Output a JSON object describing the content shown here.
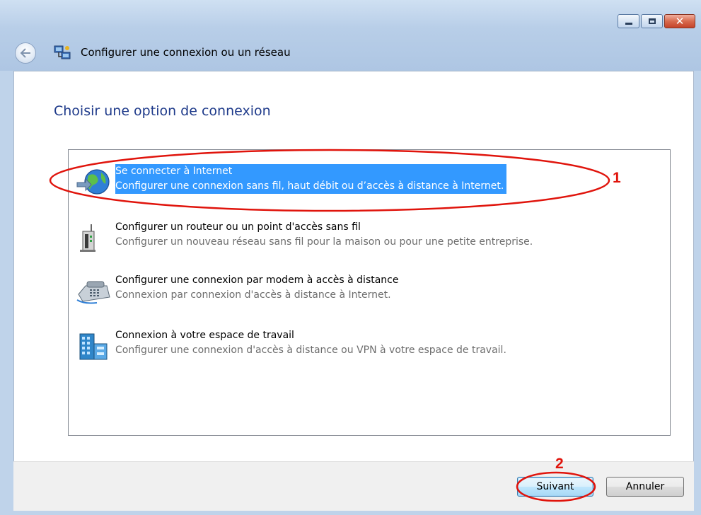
{
  "window": {
    "title": "Configurer une connexion ou un réseau",
    "caption_buttons": [
      "minimize-icon",
      "maximize-icon",
      "close-icon"
    ]
  },
  "page": {
    "heading": "Choisir une option de connexion"
  },
  "options": [
    {
      "icon": "globe-internet-icon",
      "title": "Se connecter à Internet",
      "description": "Configurer une connexion sans fil, haut débit ou d’accès à distance à Internet.",
      "selected": true
    },
    {
      "icon": "wireless-router-icon",
      "title": "Configurer un routeur ou un point d'accès sans fil",
      "description": "Configurer un nouveau réseau sans fil pour la maison ou pour une petite entreprise.",
      "selected": false
    },
    {
      "icon": "dialup-modem-phone-icon",
      "title": "Configurer une connexion par modem à accès à distance",
      "description": "Connexion par connexion d'accès à distance à Internet.",
      "selected": false
    },
    {
      "icon": "workplace-building-icon",
      "title": "Connexion à votre espace de travail",
      "description": "Configurer une connexion d'accès à distance ou VPN à votre espace de travail.",
      "selected": false
    }
  ],
  "footer": {
    "next_label": "Suivant",
    "cancel_label": "Annuler"
  },
  "annotations": {
    "step1": "1",
    "step2": "2",
    "color": "#e0140c"
  },
  "colors": {
    "selection": "#3399ff",
    "heading": "#1e3a8a"
  }
}
